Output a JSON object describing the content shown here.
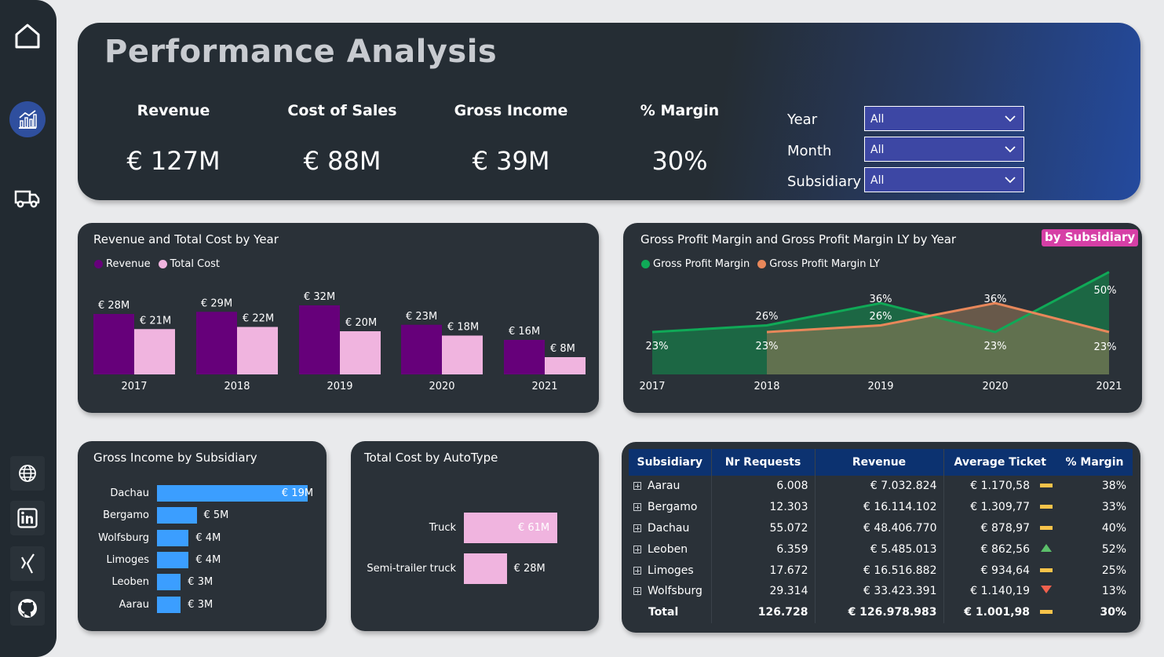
{
  "header": {
    "title": "Performance Analysis",
    "kpis": [
      {
        "label": "Revenue",
        "value": "€ 127M"
      },
      {
        "label": "Cost of Sales",
        "value": "€ 88M"
      },
      {
        "label": "Gross Income",
        "value": "€ 39M"
      },
      {
        "label": "% Margin",
        "value": "30%"
      }
    ],
    "filters": [
      {
        "label": "Year",
        "value": "All"
      },
      {
        "label": "Month",
        "value": "All"
      },
      {
        "label": "Subsidiary",
        "value": "All"
      }
    ]
  },
  "sidebar": {
    "icons": [
      "home-icon",
      "analytics-chart-icon",
      "truck-icon",
      "globe-icon",
      "linkedin-icon",
      "xing-icon",
      "github-icon"
    ],
    "active": "analytics-chart-icon",
    "active_color": "#2f4f9e"
  },
  "colors": {
    "revenue": "#66007a",
    "total_cost": "#f0b4df",
    "gross_profit_margin": "#10a957",
    "gross_profit_margin_ly": "#e8875a",
    "hbar_blue": "#3b9eff",
    "badge": "#d63fa6",
    "table_header": "#0c3270"
  },
  "chart_data": [
    {
      "type": "bar",
      "title": "Revenue and Total Cost by Year",
      "categories": [
        "2017",
        "2018",
        "2019",
        "2020",
        "2021"
      ],
      "series": [
        {
          "name": "Revenue",
          "values": [
            28,
            29,
            32,
            23,
            16
          ],
          "labels": [
            "€ 28M",
            "€ 29M",
            "€ 32M",
            "€ 23M",
            "€ 16M"
          ]
        },
        {
          "name": "Total Cost",
          "values": [
            21,
            22,
            20,
            18,
            8
          ],
          "labels": [
            "€ 21M",
            "€ 22M",
            "€ 20M",
            "€ 18M",
            "€ 8M"
          ]
        }
      ],
      "legend": "top-left"
    },
    {
      "type": "area",
      "title": "Gross Profit Margin and Gross Profit Margin LY by Year",
      "badge": "by Subsidiary",
      "x": [
        "2017",
        "2018",
        "2019",
        "2020",
        "2021"
      ],
      "series": [
        {
          "name": "Gross Profit Margin",
          "values": [
            23,
            26,
            36,
            23,
            50
          ],
          "labels": [
            "23%",
            "26%",
            "36%",
            "23%",
            "50%"
          ]
        },
        {
          "name": "Gross Profit Margin LY",
          "values": [
            null,
            23,
            26,
            36,
            23
          ],
          "labels": [
            "",
            "23%",
            "26%",
            "36%",
            "23%"
          ]
        }
      ],
      "legend": "top-left"
    },
    {
      "type": "bar",
      "orientation": "horizontal",
      "title": "Gross Income by Subsidiary",
      "categories": [
        "Dachau",
        "Bergamo",
        "Wolfsburg",
        "Limoges",
        "Leoben",
        "Aarau"
      ],
      "values": [
        19,
        5,
        4,
        4,
        3,
        3
      ],
      "labels": [
        "€ 19M",
        "€ 5M",
        "€ 4M",
        "€ 4M",
        "€ 3M",
        "€ 3M"
      ]
    },
    {
      "type": "bar",
      "orientation": "horizontal",
      "title": "Total Cost by AutoType",
      "categories": [
        "Truck",
        "Semi-trailer truck"
      ],
      "values": [
        61,
        28
      ],
      "labels": [
        "€ 61M",
        "€ 28M"
      ]
    }
  ],
  "table": {
    "columns": [
      "Subsidiary",
      "Nr Requests",
      "Revenue",
      "Average Ticket",
      "% Margin"
    ],
    "rows": [
      {
        "subsidiary": "Aarau",
        "requests": "6.008",
        "revenue": "€ 7.032.824",
        "ticket": "€ 1.170,58",
        "indicator": "flat",
        "margin": "38%"
      },
      {
        "subsidiary": "Bergamo",
        "requests": "12.303",
        "revenue": "€ 16.114.102",
        "ticket": "€ 1.309,77",
        "indicator": "flat",
        "margin": "33%"
      },
      {
        "subsidiary": "Dachau",
        "requests": "55.072",
        "revenue": "€ 48.406.770",
        "ticket": "€ 878,97",
        "indicator": "flat",
        "margin": "40%"
      },
      {
        "subsidiary": "Leoben",
        "requests": "6.359",
        "revenue": "€ 5.485.013",
        "ticket": "€ 862,56",
        "indicator": "up",
        "margin": "52%"
      },
      {
        "subsidiary": "Limoges",
        "requests": "17.672",
        "revenue": "€ 16.516.882",
        "ticket": "€ 934,64",
        "indicator": "flat",
        "margin": "25%"
      },
      {
        "subsidiary": "Wolfsburg",
        "requests": "29.314",
        "revenue": "€ 33.423.391",
        "ticket": "€ 1.140,19",
        "indicator": "down",
        "margin": "13%"
      }
    ],
    "total": {
      "subsidiary": "Total",
      "requests": "126.728",
      "revenue": "€ 126.978.983",
      "ticket": "€ 1.001,98",
      "indicator": "flat",
      "margin": "30%"
    }
  }
}
